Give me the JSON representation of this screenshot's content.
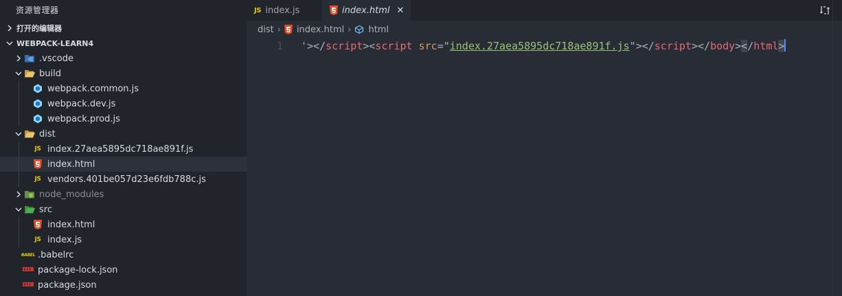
{
  "sidebar": {
    "title": "资源管理器",
    "open_editors": "打开的编辑器",
    "project": "WEBPACK-LEARN4",
    "tree": [
      {
        "label": ".vscode",
        "type": "folder",
        "expanded": false,
        "depth": 0,
        "icon": "vscode-folder-icon"
      },
      {
        "label": "build",
        "type": "folder",
        "expanded": true,
        "depth": 0,
        "icon": "folder-open-icon"
      },
      {
        "label": "webpack.common.js",
        "type": "file",
        "depth": 1,
        "icon": "webpack-icon"
      },
      {
        "label": "webpack.dev.js",
        "type": "file",
        "depth": 1,
        "icon": "webpack-icon"
      },
      {
        "label": "webpack.prod.js",
        "type": "file",
        "depth": 1,
        "icon": "webpack-icon"
      },
      {
        "label": "dist",
        "type": "folder",
        "expanded": true,
        "depth": 0,
        "icon": "folder-open-icon"
      },
      {
        "label": "index.27aea5895dc718ae891f.js",
        "type": "file",
        "depth": 1,
        "icon": "js-icon"
      },
      {
        "label": "index.html",
        "type": "file",
        "depth": 1,
        "icon": "html5-icon",
        "selected": true
      },
      {
        "label": "vendors.401be057d23e6fdb788c.js",
        "type": "file",
        "depth": 1,
        "icon": "js-icon"
      },
      {
        "label": "node_modules",
        "type": "folder",
        "expanded": false,
        "depth": 0,
        "icon": "node-folder-icon",
        "dim": true
      },
      {
        "label": "src",
        "type": "folder",
        "expanded": true,
        "depth": 0,
        "icon": "src-folder-icon"
      },
      {
        "label": "index.html",
        "type": "file",
        "depth": 1,
        "icon": "html5-icon"
      },
      {
        "label": "index.js",
        "type": "file",
        "depth": 1,
        "icon": "js-icon"
      },
      {
        "label": ".babelrc",
        "type": "file",
        "depth": 0,
        "icon": "babel-icon"
      },
      {
        "label": "package-lock.json",
        "type": "file",
        "depth": 0,
        "icon": "npm-icon"
      },
      {
        "label": "package.json",
        "type": "file",
        "depth": 0,
        "icon": "npm-icon"
      }
    ]
  },
  "tabs": [
    {
      "label": "index.js",
      "icon": "js-icon",
      "active": false
    },
    {
      "label": "index.html",
      "icon": "html5-icon",
      "active": true,
      "close": "✕"
    }
  ],
  "breadcrumb": [
    "dist",
    "index.html",
    "html"
  ],
  "editor": {
    "line_number": "1",
    "tokens": [
      {
        "t": "'",
        "c": "punct"
      },
      {
        "t": "></",
        "c": "punct"
      },
      {
        "t": "script",
        "c": "tag"
      },
      {
        "t": "><",
        "c": "punct"
      },
      {
        "t": "script",
        "c": "tag"
      },
      {
        "t": " ",
        "c": "punct"
      },
      {
        "t": "src",
        "c": "attr"
      },
      {
        "t": "=\"",
        "c": "punct"
      },
      {
        "t": "index.27aea5895dc718ae891f.js",
        "c": "link"
      },
      {
        "t": "\"",
        "c": "punct"
      },
      {
        "t": "></",
        "c": "punct"
      },
      {
        "t": "script",
        "c": "tag"
      },
      {
        "t": "></",
        "c": "punct"
      },
      {
        "t": "body",
        "c": "tag"
      },
      {
        "t": ">",
        "c": "punct"
      },
      {
        "t": "<",
        "c": "punct",
        "hl": true
      },
      {
        "t": "/",
        "c": "punct"
      },
      {
        "t": "html",
        "c": "tag"
      },
      {
        "t": ">",
        "c": "punct",
        "hl": true
      }
    ]
  },
  "colors": {
    "sidebar_bg": "#21252b",
    "editor_bg": "#282c34",
    "selection": "#2c313a",
    "js_yellow": "#e5c800",
    "html_orange": "#e44d26",
    "tag_red": "#e06c75",
    "string_green": "#98c379"
  }
}
